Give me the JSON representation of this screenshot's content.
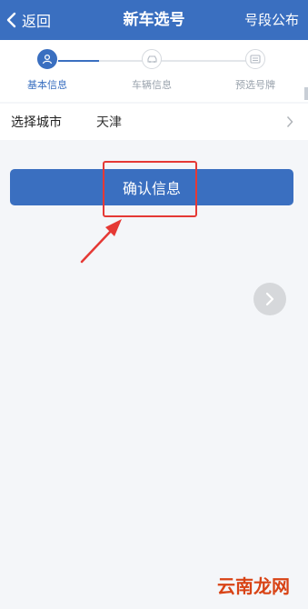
{
  "header": {
    "back_label": "返回",
    "title": "新车选号",
    "right_action": "号段公布",
    "bg_color": "#3a6fc0"
  },
  "steps": [
    {
      "label": "基本信息",
      "icon": "user-icon",
      "active": true
    },
    {
      "label": "车辆信息",
      "icon": "car-icon",
      "active": false
    },
    {
      "label": "预选号牌",
      "icon": "plate-icon",
      "active": false
    }
  ],
  "form": {
    "city_label": "选择城市",
    "city_value": "天津"
  },
  "confirm_button": "确认信息",
  "watermark": "云南龙网",
  "colors": {
    "accent": "#3a6fc0",
    "annotation_red": "#e53935"
  }
}
